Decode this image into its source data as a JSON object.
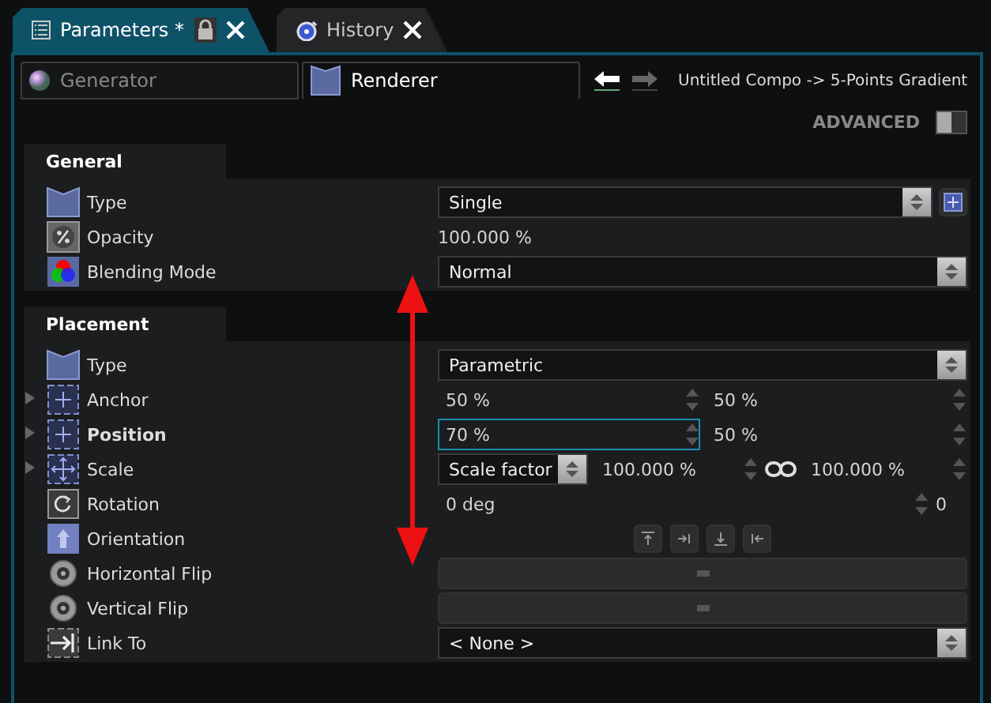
{
  "tabs": [
    {
      "label": "Parameters *",
      "selected": true,
      "locked": true
    },
    {
      "label": "History",
      "selected": false,
      "locked": false
    }
  ],
  "subtabs": [
    {
      "label": "Generator",
      "selected": false
    },
    {
      "label": "Renderer",
      "selected": true
    }
  ],
  "breadcrumb": "Untitled Compo -> 5-Points Gradient",
  "advanced": {
    "label": "ADVANCED",
    "on": false
  },
  "sections": [
    {
      "title": "General",
      "rows": [
        {
          "label": "Type",
          "expandable": false,
          "bold": false,
          "kind": "combo_add",
          "value": "Single"
        },
        {
          "label": "Opacity",
          "expandable": false,
          "bold": false,
          "kind": "text",
          "value": "100.000 %"
        },
        {
          "label": "Blending Mode",
          "expandable": false,
          "bold": false,
          "kind": "combo",
          "value": "Normal"
        }
      ]
    },
    {
      "title": "Placement",
      "rows": [
        {
          "label": "Type",
          "expandable": false,
          "bold": false,
          "kind": "combo",
          "value": "Parametric"
        },
        {
          "label": "Anchor",
          "expandable": true,
          "bold": false,
          "kind": "pair",
          "value": "50 %",
          "value2": "50 %",
          "focused": false
        },
        {
          "label": "Position",
          "expandable": true,
          "bold": true,
          "kind": "pair",
          "value": "70 %",
          "value2": "50 %",
          "focused": true
        },
        {
          "label": "Scale",
          "expandable": true,
          "bold": false,
          "kind": "scale",
          "value": "Scale factor",
          "value2": "100.000 %",
          "value3": "100.000 %"
        },
        {
          "label": "Rotation",
          "expandable": false,
          "bold": false,
          "kind": "rotation",
          "value": "0 deg",
          "value2": "0"
        },
        {
          "label": "Orientation",
          "expandable": false,
          "bold": false,
          "kind": "buttons"
        },
        {
          "label": "Horizontal Flip",
          "expandable": false,
          "bold": false,
          "kind": "flip"
        },
        {
          "label": "Vertical Flip",
          "expandable": false,
          "bold": false,
          "kind": "flip"
        },
        {
          "label": "Link To",
          "expandable": false,
          "bold": false,
          "kind": "combo",
          "value": "< None >"
        }
      ]
    }
  ]
}
